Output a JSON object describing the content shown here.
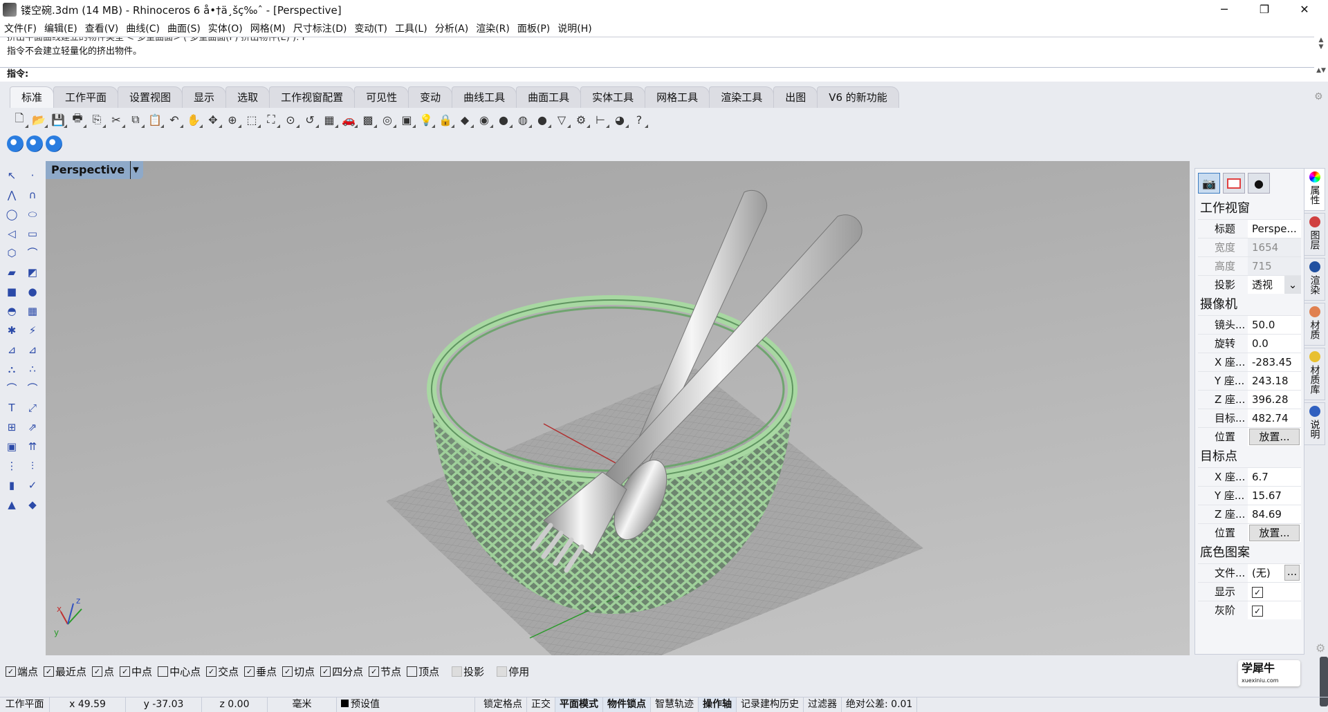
{
  "window": {
    "title": "镂空碗.3dm (14 MB) - Rhinoceros 6 å•†ä¸šç‰ˆ - [Perspective]",
    "minimize": "─",
    "maximize": "❐",
    "close": "✕"
  },
  "menu": [
    "文件(F)",
    "编辑(E)",
    "查看(V)",
    "曲线(C)",
    "曲面(S)",
    "实体(O)",
    "网格(M)",
    "尺寸标注(D)",
    "变动(T)",
    "工具(L)",
    "分析(A)",
    "渲染(R)",
    "面板(P)",
    "说明(H)"
  ],
  "command": {
    "history": [
      "挤出平面曲线建立的物件类型 < 多重曲面> ( 多重曲面(P) 挤出物件(E) ): P",
      "指令不会建立轻量化的挤出物件。"
    ],
    "prompt": "指令:"
  },
  "tabs": [
    "标准",
    "工作平面",
    "设置视图",
    "显示",
    "选取",
    "工作视窗配置",
    "可见性",
    "变动",
    "曲线工具",
    "曲面工具",
    "实体工具",
    "网格工具",
    "渲染工具",
    "出图",
    "V6 的新功能"
  ],
  "active_tab": "标准",
  "toolbar_icons": [
    "new-icon",
    "open-icon",
    "save-icon",
    "print-icon",
    "export-icon",
    "cut-icon",
    "copy-icon",
    "paste-icon",
    "undo-icon",
    "pan-icon",
    "rotate-view-icon",
    "zoom-icon",
    "zoom-window-icon",
    "zoom-extents-icon",
    "zoom-selected-icon",
    "undo-view-icon",
    "four-viewports-icon",
    "car-icon",
    "grid-icon",
    "circle-icon",
    "named-view-icon",
    "light-icon",
    "lock-icon",
    "layer-icon",
    "color-wheel-icon",
    "shaded-sphere-icon",
    "rendered-sphere-icon",
    "blue-sphere-icon",
    "render-icon",
    "options-gear-icon",
    "dimension-icon",
    "globe-icon",
    "help-icon"
  ],
  "toolbar_glyphs": [
    "🗋",
    "📂",
    "💾",
    "🖶",
    "⎘",
    "✂",
    "⧉",
    "📋",
    "↶",
    "✋",
    "✥",
    "⊕",
    "⬚",
    "⛶",
    "⊙",
    "↺",
    "▦",
    "🚗",
    "▩",
    "◎",
    "▣",
    "💡",
    "🔒",
    "◆",
    "◉",
    "●",
    "◍",
    "●",
    "▽",
    "⚙",
    "⊢",
    "◕",
    "?"
  ],
  "toolbar2_icons": [
    "sync-camera-icon",
    "refresh-icon",
    "help-camera-icon"
  ],
  "left_tools": [
    "select",
    "point",
    "polyline",
    "curve",
    "circle",
    "ellipse",
    "arc",
    "rectangle",
    "polygon",
    "fillet-curve",
    "surface-from-points",
    "edge-surface",
    "box",
    "boolean-union",
    "extrude",
    "mesh",
    "explode",
    "split",
    "trim-a",
    "trim-b",
    "group",
    "ungroup",
    "curve-fillet",
    "offset-curve",
    "text",
    "scale",
    "array",
    "rotate3d",
    "solid-tools",
    "project",
    "grid-array",
    "history",
    "analyze",
    "check",
    "primitives",
    "render-tools"
  ],
  "left_glyphs": [
    "↖",
    "·",
    "⋀",
    "∩",
    "◯",
    "⬭",
    "◁",
    "▭",
    "⬡",
    "⌒",
    "▰",
    "◩",
    "■",
    "●",
    "◓",
    "▦",
    "✱",
    "⚡",
    "⊿",
    "⊿",
    "⛬",
    "∴",
    "⌒",
    "⌒",
    "T",
    "⤢",
    "⊞",
    "⇗",
    "▣",
    "⇈",
    "⋮",
    "⫶",
    "▮",
    "✓",
    "▲",
    "◆"
  ],
  "viewport": {
    "label": "Perspective",
    "axes": {
      "x": "x",
      "y": "y",
      "z": "z"
    }
  },
  "panel": {
    "sections": {
      "viewport": "工作视窗",
      "camera": "摄像机",
      "target": "目标点",
      "wallpaper": "底色图案"
    },
    "viewport_rows": [
      {
        "k": "标题",
        "v": "Perspe..."
      },
      {
        "k": "宽度",
        "v": "1654"
      },
      {
        "k": "高度",
        "v": "715"
      },
      {
        "k": "投影",
        "v": "透视"
      }
    ],
    "camera_rows": [
      {
        "k": "镜头...",
        "v": "50.0"
      },
      {
        "k": "旋转",
        "v": "0.0"
      },
      {
        "k": "X 座...",
        "v": "-283.45"
      },
      {
        "k": "Y 座...",
        "v": "243.18"
      },
      {
        "k": "Z 座...",
        "v": "396.28"
      },
      {
        "k": "目标...",
        "v": "482.74"
      },
      {
        "k": "位置",
        "v": "放置..."
      }
    ],
    "target_rows": [
      {
        "k": "X 座...",
        "v": "6.7"
      },
      {
        "k": "Y 座...",
        "v": "15.67"
      },
      {
        "k": "Z 座...",
        "v": "84.69"
      },
      {
        "k": "位置",
        "v": "放置..."
      }
    ],
    "wallpaper_rows": [
      {
        "k": "文件...",
        "v": "(无)",
        "btn": "..."
      },
      {
        "k": "显示",
        "checked": true
      },
      {
        "k": "灰阶",
        "checked": true
      }
    ]
  },
  "side_tabs": [
    "属性",
    "图层",
    "渲染",
    "材质",
    "材质库",
    "说明"
  ],
  "osnaps": [
    {
      "label": "端点",
      "checked": true
    },
    {
      "label": "最近点",
      "checked": true
    },
    {
      "label": "点",
      "checked": true
    },
    {
      "label": "中点",
      "checked": true
    },
    {
      "label": "中心点",
      "checked": false
    },
    {
      "label": "交点",
      "checked": true
    },
    {
      "label": "垂点",
      "checked": true
    },
    {
      "label": "切点",
      "checked": true
    },
    {
      "label": "四分点",
      "checked": true
    },
    {
      "label": "节点",
      "checked": true
    },
    {
      "label": "顶点",
      "checked": false
    },
    {
      "label": "投影",
      "checked": false,
      "disabled": true
    },
    {
      "label": "停用",
      "checked": false,
      "disabled": true
    }
  ],
  "status": {
    "cplane": "工作平面",
    "x": "x 49.59",
    "y": "y -37.03",
    "z": "z 0.00",
    "units": "毫米",
    "layer": "预设值",
    "toggles": [
      {
        "label": "锁定格点",
        "on": false
      },
      {
        "label": "正交",
        "on": false
      },
      {
        "label": "平面模式",
        "on": true
      },
      {
        "label": "物件锁点",
        "on": true
      },
      {
        "label": "智慧轨迹",
        "on": false
      },
      {
        "label": "操作轴",
        "on": true
      },
      {
        "label": "记录建构历史",
        "on": false
      },
      {
        "label": "过滤器",
        "on": false
      }
    ],
    "tolerance": "绝对公差: 0.01"
  },
  "watermark": {
    "text": "学犀牛",
    "url": "xuexiniu.com"
  },
  "colors": {
    "bowl": "#8fc48f",
    "bowl_dark": "#3f6b44",
    "utensil": "#d8d8d8",
    "vp_label": "#8ea9c9"
  }
}
